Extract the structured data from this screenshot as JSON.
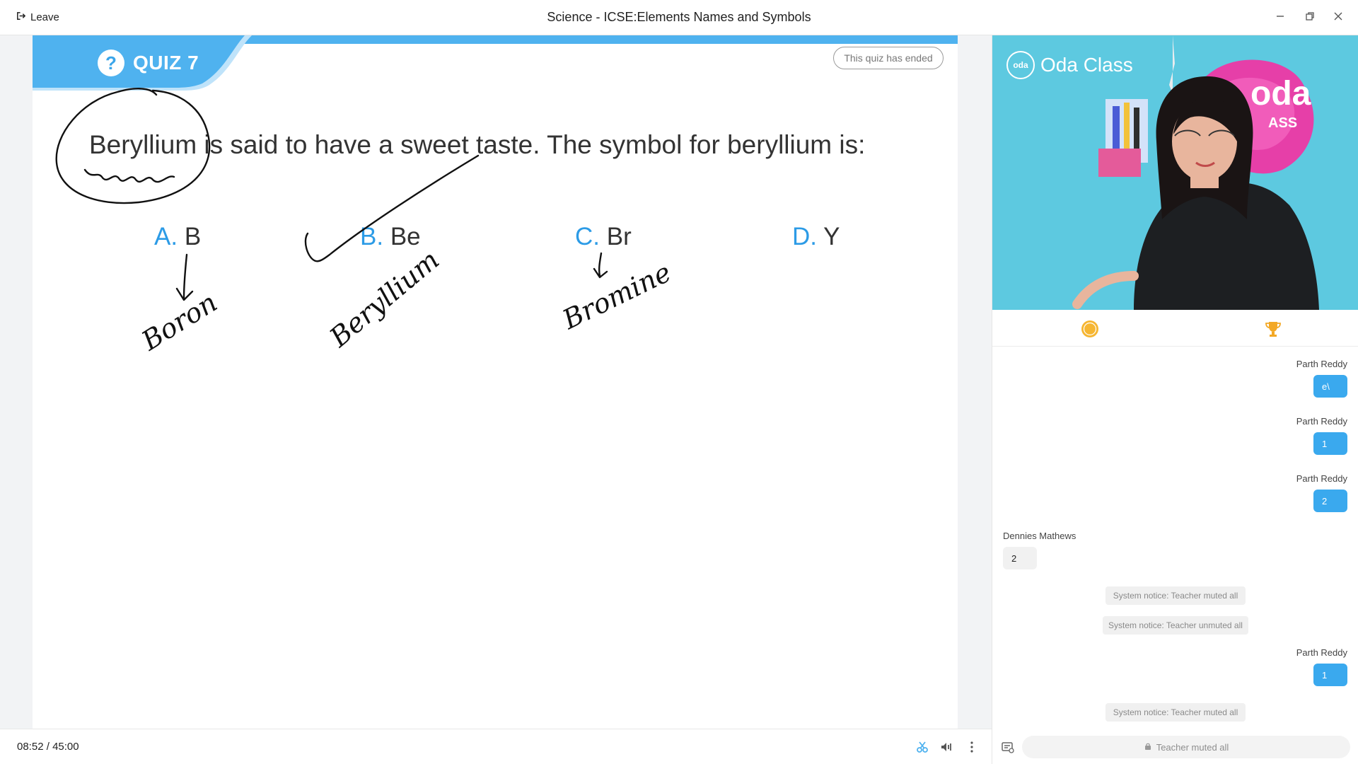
{
  "window": {
    "leave_label": "Leave",
    "title": "Science - ICSE:Elements Names and Symbols",
    "icons": [
      "leave-icon",
      "minimize-icon",
      "restore-icon",
      "close-icon"
    ]
  },
  "quiz": {
    "badge": "QUIZ 7",
    "status": "This quiz has ended",
    "question": "Beryllium is said to have a sweet taste. The symbol for beryllium is:",
    "options": [
      {
        "letter": "A.",
        "text": "B"
      },
      {
        "letter": "B.",
        "text": "Be"
      },
      {
        "letter": "C.",
        "text": "Br"
      },
      {
        "letter": "D.",
        "text": "Y"
      }
    ],
    "annotations": [
      "Boron",
      "Beryllium",
      "Bromine"
    ],
    "accent_color": "#4fb2ef"
  },
  "player": {
    "elapsed": "08:52",
    "separator": "/",
    "total": "45:00",
    "icons": [
      "clip-icon",
      "volume-icon",
      "more-icon"
    ]
  },
  "video": {
    "brand_logo": "oda",
    "brand_name": "Oda Class",
    "backdrop_text": "oda",
    "backdrop_sub": "ASS"
  },
  "side_tabs": [
    "oda-coin-icon",
    "trophy-icon"
  ],
  "chat": {
    "messages": [
      {
        "sender": "Parth Reddy",
        "text": "e\\",
        "own": true
      },
      {
        "sender": "Parth Reddy",
        "text": "1",
        "own": true
      },
      {
        "sender": "Parth Reddy",
        "text": "2",
        "own": true
      },
      {
        "sender": "Dennies Mathews",
        "text": "2",
        "own": false
      },
      {
        "notice": "System notice: Teacher muted all"
      },
      {
        "notice": "System notice: Teacher unmuted all"
      },
      {
        "sender": "Parth Reddy",
        "text": "1",
        "own": true
      },
      {
        "notice": "System notice: Teacher muted all"
      }
    ],
    "input_placeholder": "Teacher muted all"
  }
}
